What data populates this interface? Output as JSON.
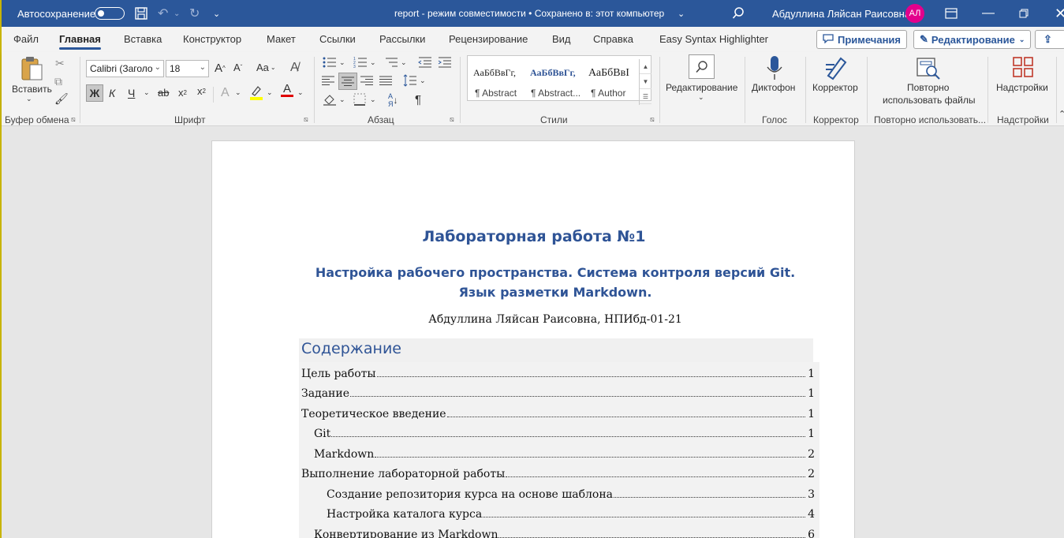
{
  "titlebar": {
    "autosave_label": "Автосохранение",
    "doc_status": "report  -  режим совместимости  •  Сохранено в: этот компьютер",
    "user_name": "Абдуллина Ляйсан Раисовна",
    "avatar_initials": "АЛ",
    "accent": "#2b579a"
  },
  "tabs": [
    {
      "label": "Файл"
    },
    {
      "label": "Главная"
    },
    {
      "label": "Вставка"
    },
    {
      "label": "Конструктор"
    },
    {
      "label": "Макет"
    },
    {
      "label": "Ссылки"
    },
    {
      "label": "Рассылки"
    },
    {
      "label": "Рецензирование"
    },
    {
      "label": "Вид"
    },
    {
      "label": "Справка"
    },
    {
      "label": "Easy Syntax Highlighter"
    }
  ],
  "active_tab": "Главная",
  "tab_actions": {
    "comments": "Примечания",
    "editing": "Редактирование"
  },
  "ribbon": {
    "clipboard": {
      "paste": "Вставить",
      "group": "Буфер обмена"
    },
    "font": {
      "font_name": "Calibri (Заголо",
      "font_size": "18",
      "bold": "Ж",
      "italic": "К",
      "underline": "Ч",
      "strike": "ab",
      "grow": "A",
      "shrink": "A",
      "case": "Aa",
      "effects": "A",
      "color_a": "A",
      "group": "Шрифт"
    },
    "paragraph": {
      "group": "Абзац"
    },
    "styles": {
      "items": [
        {
          "preview": "АаБбВвГг,",
          "name": "¶ Abstract"
        },
        {
          "preview": "АаБбВвГг,",
          "name": "¶ Abstract..."
        },
        {
          "preview": "АаБбВвI",
          "name": "¶ Author"
        }
      ],
      "group": "Стили"
    },
    "editing": {
      "label": "Редактирование"
    },
    "voice": {
      "button": "Диктофон",
      "group": "Голос"
    },
    "editor": {
      "button": "Корректор",
      "group": "Корректор"
    },
    "reuse": {
      "button_line1": "Повторно",
      "button_line2": "использовать файлы",
      "group": "Повторно использовать..."
    },
    "addins": {
      "button": "Надстройки",
      "group": "Надстройки"
    }
  },
  "document": {
    "title": "Лабораторная работа №1",
    "subtitle": "Настройка рабочего пространства. Система контроля версий Git. Язык разметки Markdown.",
    "author": "Абдуллина Ляйсан Раисовна, НПИбд-01-21",
    "toc_heading": "Содержание",
    "toc": [
      {
        "text": "Цель работы",
        "page": "1",
        "level": 1
      },
      {
        "text": "Задание",
        "page": "1",
        "level": 1
      },
      {
        "text": "Теоретическое введение",
        "page": "1",
        "level": 1
      },
      {
        "text": "Git",
        "page": "1",
        "level": 2
      },
      {
        "text": "Markdown",
        "page": "2",
        "level": 2
      },
      {
        "text": "Выполнение лабораторной работы",
        "page": "2",
        "level": 1
      },
      {
        "text": "Создание репозитория курса на основе шаблона",
        "page": "3",
        "level": 3
      },
      {
        "text": "Настройка каталога курса",
        "page": "4",
        "level": 3
      },
      {
        "text": "Конвертирование из Markdown",
        "page": "6",
        "level": 2
      }
    ]
  }
}
